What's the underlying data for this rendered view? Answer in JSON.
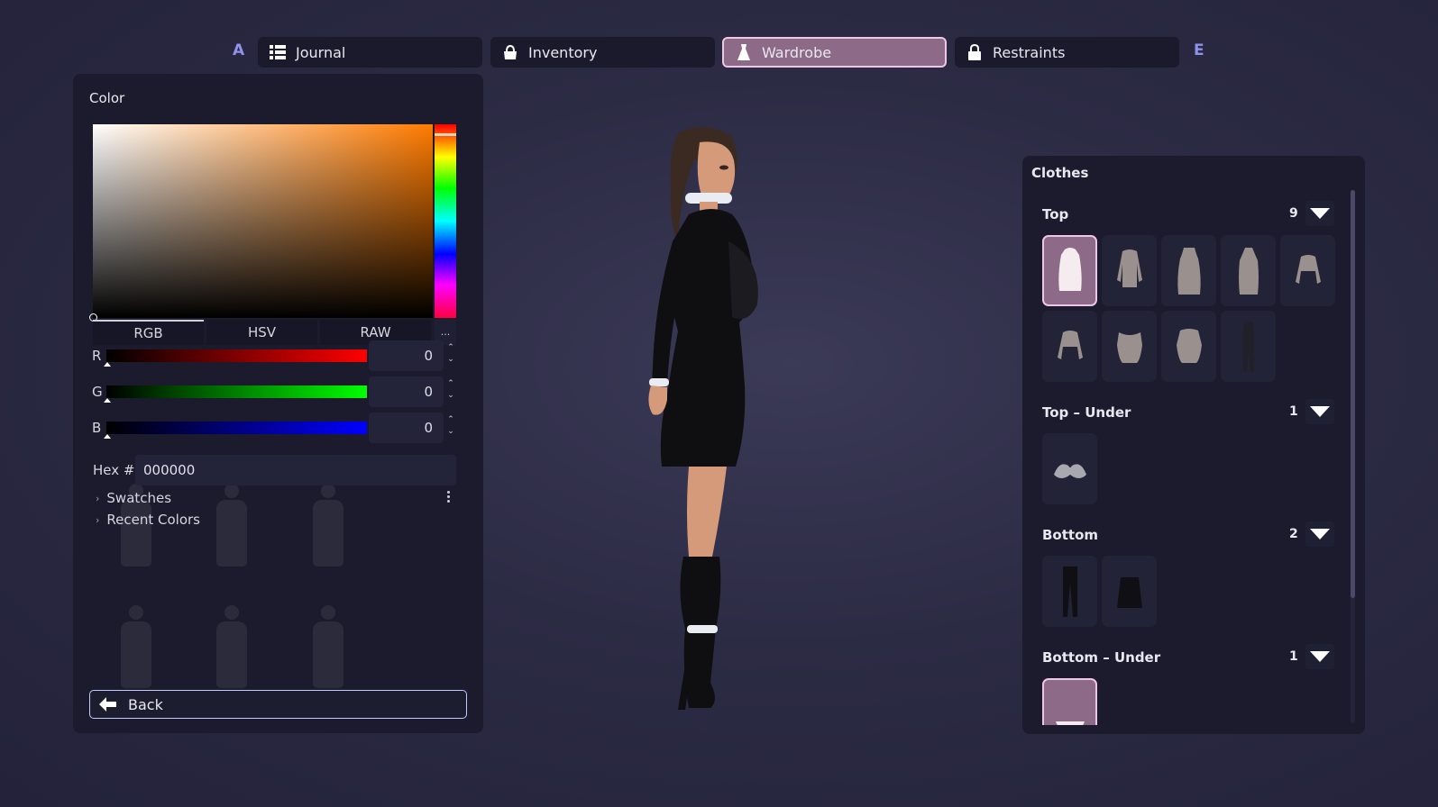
{
  "nav": {
    "prev_hint": "A",
    "next_hint": "E",
    "tabs": [
      {
        "label": "Journal",
        "icon": "list-icon",
        "active": false
      },
      {
        "label": "Inventory",
        "icon": "bag-icon",
        "active": false
      },
      {
        "label": "Wardrobe",
        "icon": "dress-icon",
        "active": true
      },
      {
        "label": "Restraints",
        "icon": "lock-icon",
        "active": false
      }
    ]
  },
  "color_panel": {
    "title": "Color",
    "modes": [
      "RGB",
      "HSV",
      "RAW"
    ],
    "active_mode": "RGB",
    "more_label": "...",
    "channels": [
      {
        "label": "R",
        "value": "0",
        "color": "#ff0000"
      },
      {
        "label": "G",
        "value": "0",
        "color": "#00ff00"
      },
      {
        "label": "B",
        "value": "0",
        "color": "#0000ff"
      }
    ],
    "hex_label": "Hex #",
    "hex_value": "000000",
    "sections": [
      "Swatches",
      "Recent Colors"
    ],
    "back_label": "Back",
    "picker_hue_color": "#ff7b00"
  },
  "clothes": {
    "title": "Clothes",
    "categories": [
      {
        "name": "Top",
        "count": "9",
        "items": 9,
        "selected_index": 0
      },
      {
        "name": "Top – Under",
        "count": "1",
        "items": 1,
        "selected_index": -1
      },
      {
        "name": "Bottom",
        "count": "2",
        "items": 2,
        "selected_index": -1
      },
      {
        "name": "Bottom – Under",
        "count": "1",
        "items": 1,
        "selected_index": 0
      }
    ]
  },
  "colors": {
    "accent": "#8d6a87",
    "accent_border": "#efc6e6",
    "panel_bg": "#1b1b2d",
    "hint": "#8f93e8"
  }
}
